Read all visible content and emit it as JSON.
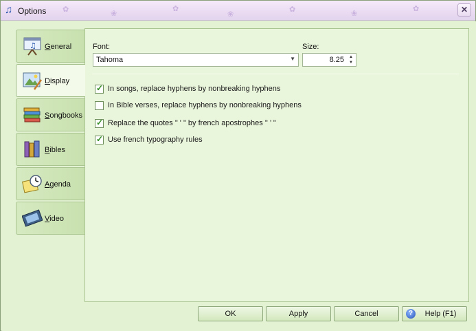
{
  "window": {
    "title": "Options",
    "close_glyph": "✕"
  },
  "tabs": [
    {
      "label": "General",
      "icon": "general-presentation-icon"
    },
    {
      "label": "Display",
      "icon": "display-picture-icon"
    },
    {
      "label": "Songbooks",
      "icon": "songbooks-books-icon"
    },
    {
      "label": "Bibles",
      "icon": "bibles-books-icon"
    },
    {
      "label": "Agenda",
      "icon": "agenda-clock-icon"
    },
    {
      "label": "Video",
      "icon": "video-film-icon"
    }
  ],
  "active_tab": "Display",
  "display": {
    "font_label": "Font:",
    "font_value": "Tahoma",
    "size_label": "Size:",
    "size_value": "8.25",
    "options": [
      {
        "label": "In songs, replace hyphens by nonbreaking hyphens",
        "checked": true
      },
      {
        "label": "In Bible verses, replace hyphens by nonbreaking hyphens",
        "checked": false
      },
      {
        "label": "Replace the quotes \" ' \" by french apostrophes \" ’ \"",
        "checked": true
      },
      {
        "label": "Use french typography rules",
        "checked": true
      }
    ]
  },
  "buttons": {
    "ok": "OK",
    "apply": "Apply",
    "cancel": "Cancel",
    "help": "Help (F1)"
  },
  "colors": {
    "background": "#e2f2d2",
    "titlebar": "#eadbf2",
    "check": "#2e8a1e"
  }
}
